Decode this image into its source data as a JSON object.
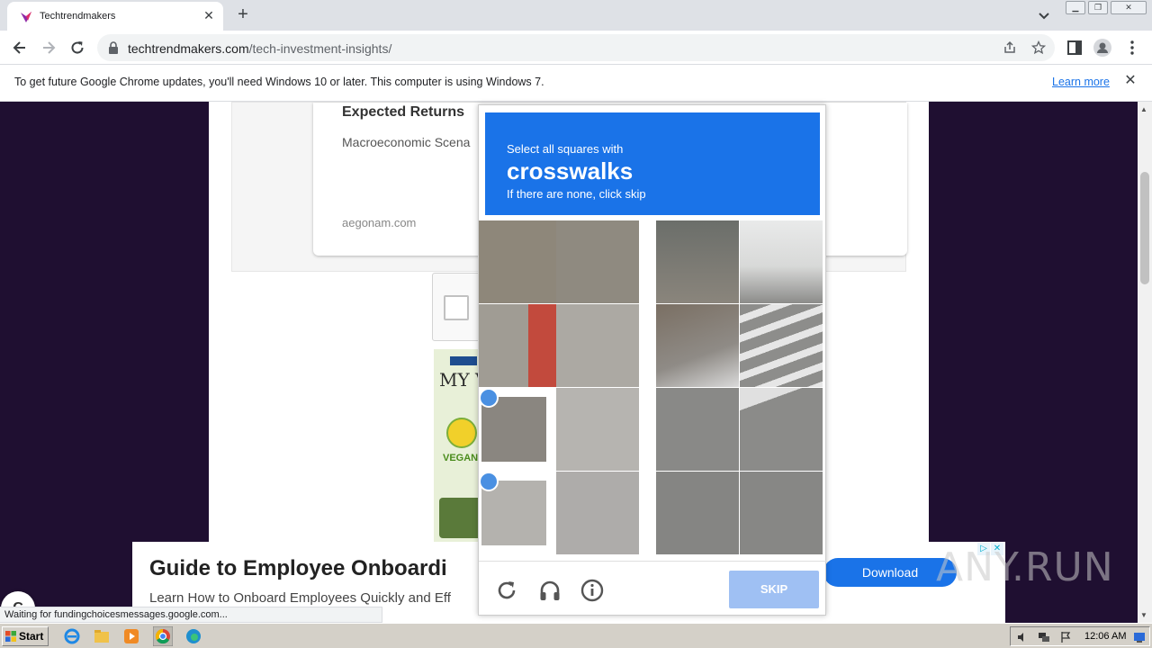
{
  "browser": {
    "tab_title": "Techtrendmakers",
    "url_domain": "techtrendmakers.com",
    "url_path": "/tech-investment-insights/",
    "infobar_message": "To get future Google Chrome updates, you'll need Windows 10 or later. This computer is using Windows 7.",
    "infobar_link": "Learn more",
    "status_text": "Waiting for fundingchoicesmessages.google.com..."
  },
  "page": {
    "card_title": "Expected Returns",
    "card_subtitle": "Macroeconomic Scena",
    "card_domain": "aegonam.com",
    "ad_brand": "MY V",
    "ad_vegan": "VEGAN",
    "chat_bubble": "C"
  },
  "banner": {
    "title": "Guide to Employee Onboardi",
    "subtitle": "Learn How to Onboard Employees Quickly and Eff",
    "button": "Download"
  },
  "watermark": "ANY.RUN",
  "captcha": {
    "lead": "Select all squares with",
    "target": "crosswalks",
    "hint": "If there are none, click skip",
    "skip_label": "SKIP",
    "selected_tiles": [
      {
        "row": 3,
        "col": 1
      },
      {
        "row": 4,
        "col": 1
      }
    ],
    "footer_icons": [
      "reload-icon",
      "audio-icon",
      "info-icon"
    ]
  },
  "taskbar": {
    "start_label": "Start",
    "clock": "12:06 AM",
    "pinned_icons": [
      "ie-icon",
      "explorer-icon",
      "media-player-icon",
      "chrome-icon",
      "edge-icon"
    ]
  },
  "colors": {
    "captcha_blue": "#1a73e8",
    "skip_disabled": "#9fc0f3",
    "page_backdrop": "#1f0f31"
  }
}
